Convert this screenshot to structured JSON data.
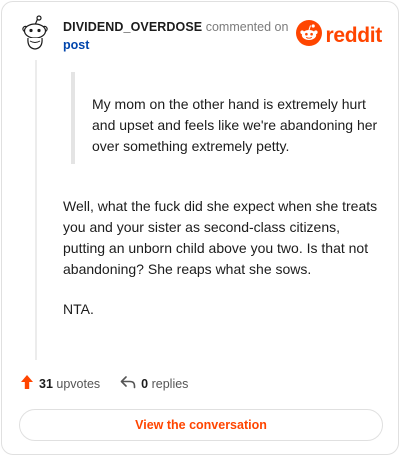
{
  "comment": {
    "username": "DIVIDEND_OVERDOSE",
    "action_text": "commented on",
    "post_link_label": "post",
    "quote": "My mom on the other hand is extremely hurt and upset and feels like we're abandoning her over something extremely petty.",
    "paragraphs": [
      "Well, what the fuck did she expect when she treats you and your sister as second-class citizens, putting an unborn child above you two. Is that not abandoning? She reaps what she sows.",
      "NTA."
    ],
    "upvotes": "31",
    "upvotes_label": "upvotes",
    "replies": "0",
    "replies_label": "replies"
  },
  "brand": {
    "name": "reddit",
    "color": "#ff4500"
  },
  "cta": {
    "label": "View the conversation"
  },
  "icons": {
    "avatar": "snoo-avatar-icon",
    "logo": "reddit-logo-icon",
    "upvote": "upvote-arrow-icon",
    "reply": "reply-arrow-icon"
  }
}
